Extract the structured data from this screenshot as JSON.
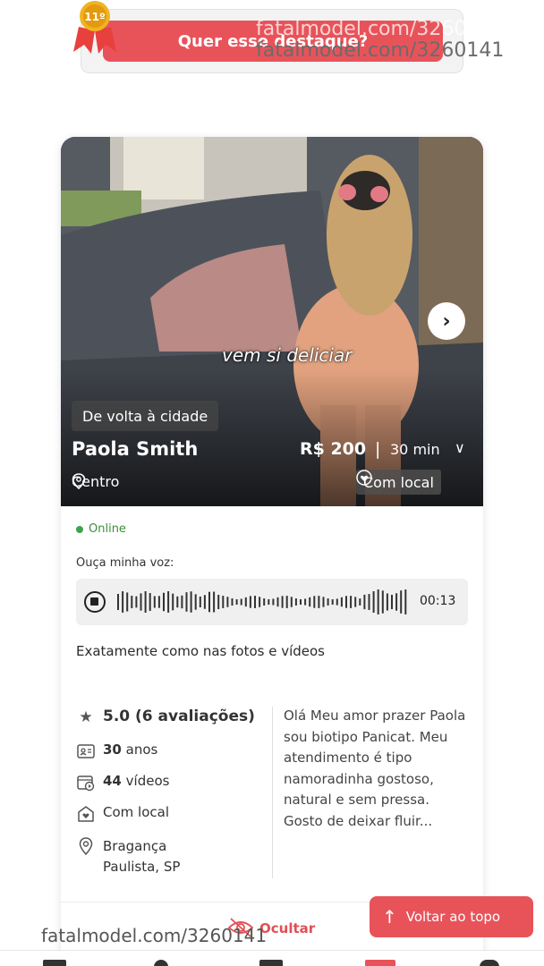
{
  "banner": {
    "rank": "11º",
    "cta_label": "Quer esse destaque?",
    "watermark_top": "fatalmodel.com/3260141"
  },
  "profile": {
    "badge": "De volta à cidade",
    "name": "Paola Smith",
    "price": "R$ 200",
    "duration": "30 min",
    "neighborhood": "Centro",
    "local_tag": "Com local",
    "photo_caption": "vem si deliciar",
    "status": "Online",
    "voice_label": "Ouça minha voz:",
    "audio_time": "00:13",
    "tagline": "Exatamente como nas fotos e vídeos",
    "rating": "5.0 (6 avaliações)",
    "age_num": "30",
    "age_unit": "anos",
    "videos_num": "44",
    "videos_unit": "vídeos",
    "place": "Com local",
    "city_line1": "Bragança",
    "city_line2": "Paulista, SP",
    "bio": "Olá Meu amor prazer Paola sou biotipo Panicat. Meu atendimento é tipo namoradinha gostoso, natural e sem pressa. Gosto de deixar fluir..."
  },
  "actions": {
    "hide_label": "Ocultar",
    "back_to_top_label": "Voltar ao topo"
  },
  "watermark_bottom": "fatalmodel.com/3260141",
  "icons": [
    "medal-icon",
    "chevron-right-icon",
    "chevron-down-icon",
    "map-pin-icon",
    "home-heart-icon",
    "stop-icon",
    "star-icon",
    "id-card-icon",
    "video-icon",
    "eye-off-icon",
    "arrow-up-icon"
  ],
  "colors": {
    "accent": "#e8535a",
    "online": "#3fa34d"
  }
}
